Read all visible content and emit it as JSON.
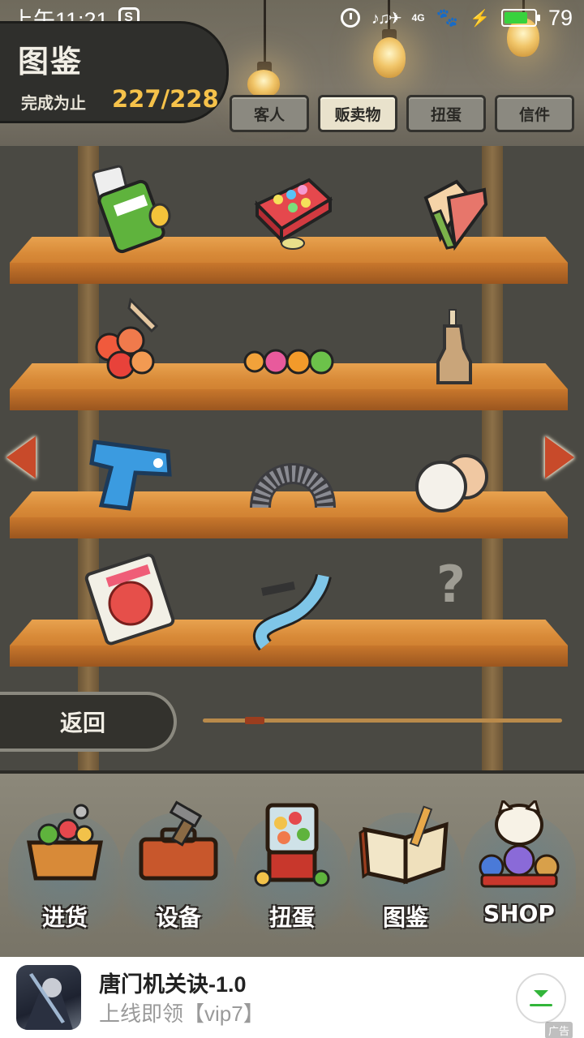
{
  "status_bar": {
    "time": "上午11:21",
    "app_icon": "S",
    "network": "4G",
    "battery_percent": "79",
    "battery_level": 0.79
  },
  "header": {
    "title": "图鉴",
    "progress_label": "完成为止",
    "progress_count": "227/228"
  },
  "tabs": [
    {
      "label": "客人",
      "active": false
    },
    {
      "label": "贩卖物",
      "active": true
    },
    {
      "label": "扭蛋",
      "active": false
    },
    {
      "label": "信件",
      "active": false
    }
  ],
  "shelves": [
    {
      "items": [
        "chips-bag-icon",
        "candy-box-icon",
        "ice-cream-cones-icon"
      ]
    },
    {
      "items": [
        "fruit-candy-bundle-icon",
        "marble-candies-icon",
        "ramune-bottle-icon"
      ]
    },
    {
      "items": [
        "water-pistol-icon",
        "slinky-icon",
        "balloons-icon"
      ]
    },
    {
      "items": [
        "sakura-candy-bag-icon",
        "party-blower-icon",
        "unknown-item"
      ]
    }
  ],
  "unknown_symbol": "?",
  "back_label": "返回",
  "page_indicator": {
    "current": 2,
    "total": 9
  },
  "bottom_nav": [
    {
      "label": "进货",
      "icon": "stock-crate-icon"
    },
    {
      "label": "设备",
      "icon": "toolbox-icon"
    },
    {
      "label": "扭蛋",
      "icon": "gacha-machine-icon"
    },
    {
      "label": "图鉴",
      "icon": "open-book-icon"
    },
    {
      "label": "SHOP",
      "icon": "lucky-cat-icon"
    }
  ],
  "ad": {
    "title": "唐门机关诀-1.0",
    "subtitle": "上线即领【vip7】",
    "tag": "广告"
  },
  "colors": {
    "accent_gold": "#f6c24a",
    "arrow_red": "#c84a2a",
    "battery_green": "#38d23d",
    "download_green": "#32b53a"
  }
}
